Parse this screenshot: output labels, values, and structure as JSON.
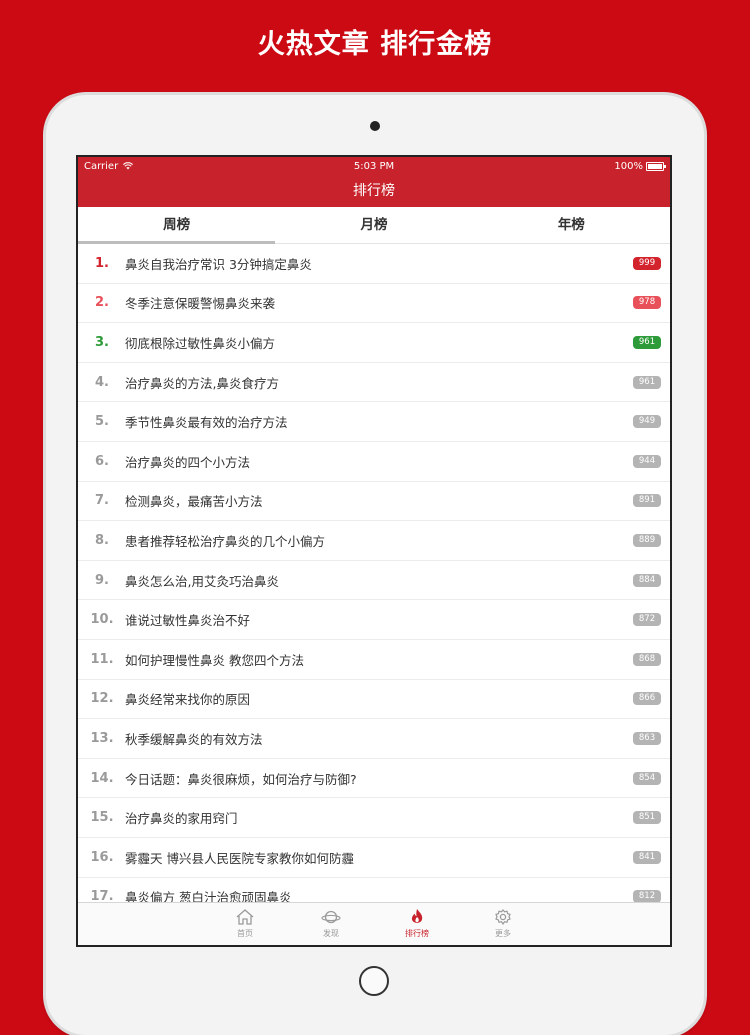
{
  "promo_title": "火热文章 排行金榜",
  "status_bar": {
    "carrier": "Carrier",
    "time": "5:03 PM",
    "battery": "100%"
  },
  "nav_title": "排行榜",
  "tabs": [
    {
      "label": "周榜",
      "active": true
    },
    {
      "label": "月榜",
      "active": false
    },
    {
      "label": "年榜",
      "active": false
    }
  ],
  "colors": {
    "red": "#c8232c",
    "green": "#2e9b3a",
    "gray": "#b4b4b4"
  },
  "articles": [
    {
      "rank": "1.",
      "title": "鼻炎自我治疗常识 3分钟搞定鼻炎",
      "count": "999",
      "color": "#d3232d"
    },
    {
      "rank": "2.",
      "title": "冬季注意保暖警惕鼻炎来袭",
      "count": "978",
      "color": "#e8505a"
    },
    {
      "rank": "3.",
      "title": "彻底根除过敏性鼻炎小偏方",
      "count": "961",
      "color": "#2e9b3a"
    },
    {
      "rank": "4.",
      "title": "治疗鼻炎的方法,鼻炎食疗方",
      "count": "961",
      "color": ""
    },
    {
      "rank": "5.",
      "title": "季节性鼻炎最有效的治疗方法",
      "count": "949",
      "color": ""
    },
    {
      "rank": "6.",
      "title": "治疗鼻炎的四个小方法",
      "count": "944",
      "color": ""
    },
    {
      "rank": "7.",
      "title": "检测鼻炎，最痛苦小方法",
      "count": "891",
      "color": ""
    },
    {
      "rank": "8.",
      "title": "患者推荐轻松治疗鼻炎的几个小偏方",
      "count": "889",
      "color": ""
    },
    {
      "rank": "9.",
      "title": "鼻炎怎么治,用艾灸巧治鼻炎",
      "count": "884",
      "color": ""
    },
    {
      "rank": "10.",
      "title": "谁说过敏性鼻炎治不好",
      "count": "872",
      "color": ""
    },
    {
      "rank": "11.",
      "title": "如何护理慢性鼻炎 教您四个方法",
      "count": "868",
      "color": ""
    },
    {
      "rank": "12.",
      "title": "鼻炎经常来找你的原因",
      "count": "866",
      "color": ""
    },
    {
      "rank": "13.",
      "title": "秋季缓解鼻炎的有效方法",
      "count": "863",
      "color": ""
    },
    {
      "rank": "14.",
      "title": "今日话题：鼻炎很麻烦，如何治疗与防御?",
      "count": "854",
      "color": ""
    },
    {
      "rank": "15.",
      "title": "治疗鼻炎的家用窍门",
      "count": "851",
      "color": ""
    },
    {
      "rank": "16.",
      "title": "雾霾天 博兴县人民医院专家教你如何防霾",
      "count": "841",
      "color": ""
    },
    {
      "rank": "17.",
      "title": "鼻炎偏方 葱白汁治愈顽固鼻炎",
      "count": "812",
      "color": ""
    }
  ],
  "tabbar": [
    {
      "label": "首页",
      "icon": "home-icon",
      "active": false
    },
    {
      "label": "发现",
      "icon": "planet-icon",
      "active": false
    },
    {
      "label": "排行榜",
      "icon": "flame-icon",
      "active": true
    },
    {
      "label": "更多",
      "icon": "gear-icon",
      "active": false
    }
  ]
}
